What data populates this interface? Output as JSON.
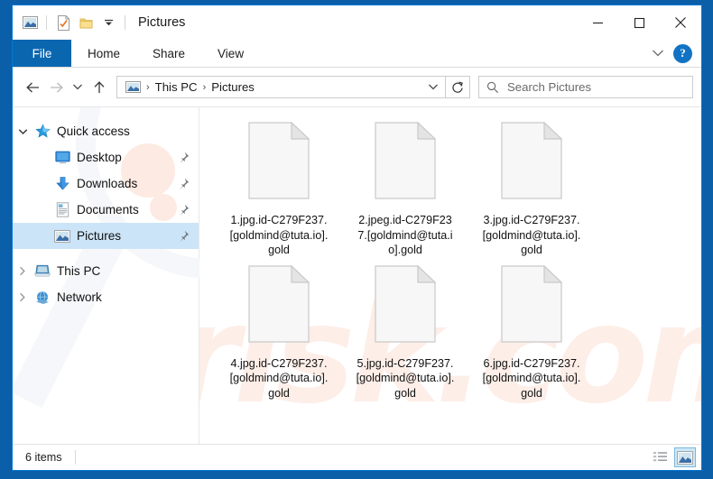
{
  "window": {
    "title": "Pictures",
    "quick_access_toolbar": [
      {
        "name": "pictures-library-icon",
        "label": "Pictures"
      },
      {
        "name": "properties-icon",
        "label": "Properties"
      },
      {
        "name": "new-folder-icon",
        "label": "New folder"
      },
      {
        "name": "customize-dropdown-icon",
        "label": "Customize Quick Access Toolbar"
      }
    ],
    "controls": {
      "minimize": "Minimize",
      "maximize": "Maximize",
      "close": "Close"
    }
  },
  "ribbon": {
    "tabs": [
      {
        "label": "File",
        "active": true
      },
      {
        "label": "Home",
        "active": false
      },
      {
        "label": "Share",
        "active": false
      },
      {
        "label": "View",
        "active": false
      }
    ],
    "expand_label": "Expand the Ribbon",
    "help_label": "?"
  },
  "navbar": {
    "back_label": "Back",
    "forward_label": "Forward",
    "recent_label": "Recent locations",
    "up_label": "Up",
    "refresh_label": "Refresh",
    "address_dropdown_label": "Previous Locations",
    "breadcrumb": [
      {
        "label": "This PC"
      },
      {
        "label": "Pictures"
      }
    ],
    "breadcrumb_separator": "›"
  },
  "search": {
    "placeholder": "Search Pictures",
    "value": ""
  },
  "sidebar": {
    "items": [
      {
        "label": "Quick access",
        "icon": "star-icon",
        "level": 0,
        "chevron": "expanded",
        "pinned": false,
        "selected": false
      },
      {
        "label": "Desktop",
        "icon": "desktop-icon",
        "level": 1,
        "chevron": "none",
        "pinned": true,
        "selected": false
      },
      {
        "label": "Downloads",
        "icon": "downloads-icon",
        "level": 1,
        "chevron": "none",
        "pinned": true,
        "selected": false
      },
      {
        "label": "Documents",
        "icon": "documents-icon",
        "level": 1,
        "chevron": "none",
        "pinned": true,
        "selected": false
      },
      {
        "label": "Pictures",
        "icon": "pictures-icon",
        "level": 1,
        "chevron": "none",
        "pinned": true,
        "selected": true
      },
      {
        "label": "This PC",
        "icon": "this-pc-icon",
        "level": 0,
        "chevron": "collapsed",
        "pinned": false,
        "selected": false
      },
      {
        "label": "Network",
        "icon": "network-icon",
        "level": 0,
        "chevron": "collapsed",
        "pinned": false,
        "selected": false
      }
    ]
  },
  "files": [
    {
      "name": "1.jpg.id-C279F237.[goldmind@tuta.io].gold",
      "icon": "blank-file-icon"
    },
    {
      "name": "2.jpeg.id-C279F237.[goldmind@tuta.io].gold",
      "icon": "blank-file-icon"
    },
    {
      "name": "3.jpg.id-C279F237.[goldmind@tuta.io].gold",
      "icon": "blank-file-icon"
    },
    {
      "name": "4.jpg.id-C279F237.[goldmind@tuta.io].gold",
      "icon": "blank-file-icon"
    },
    {
      "name": "5.jpg.id-C279F237.[goldmind@tuta.io].gold",
      "icon": "blank-file-icon"
    },
    {
      "name": "6.jpg.id-C279F237.[goldmind@tuta.io].gold",
      "icon": "blank-file-icon"
    }
  ],
  "statusbar": {
    "item_count": "6 items",
    "views": [
      {
        "name": "details-view",
        "label": "Details",
        "active": false
      },
      {
        "name": "large-icons-view",
        "label": "Large icons",
        "active": true
      }
    ]
  },
  "watermark": {
    "text": "risk.com"
  },
  "colors": {
    "window_border": "#0078d7",
    "desktop_background": "#0b5ea8",
    "file_tab": "#0b66b0",
    "selection": "#cce4f7",
    "watermark": "#fdeee8"
  }
}
